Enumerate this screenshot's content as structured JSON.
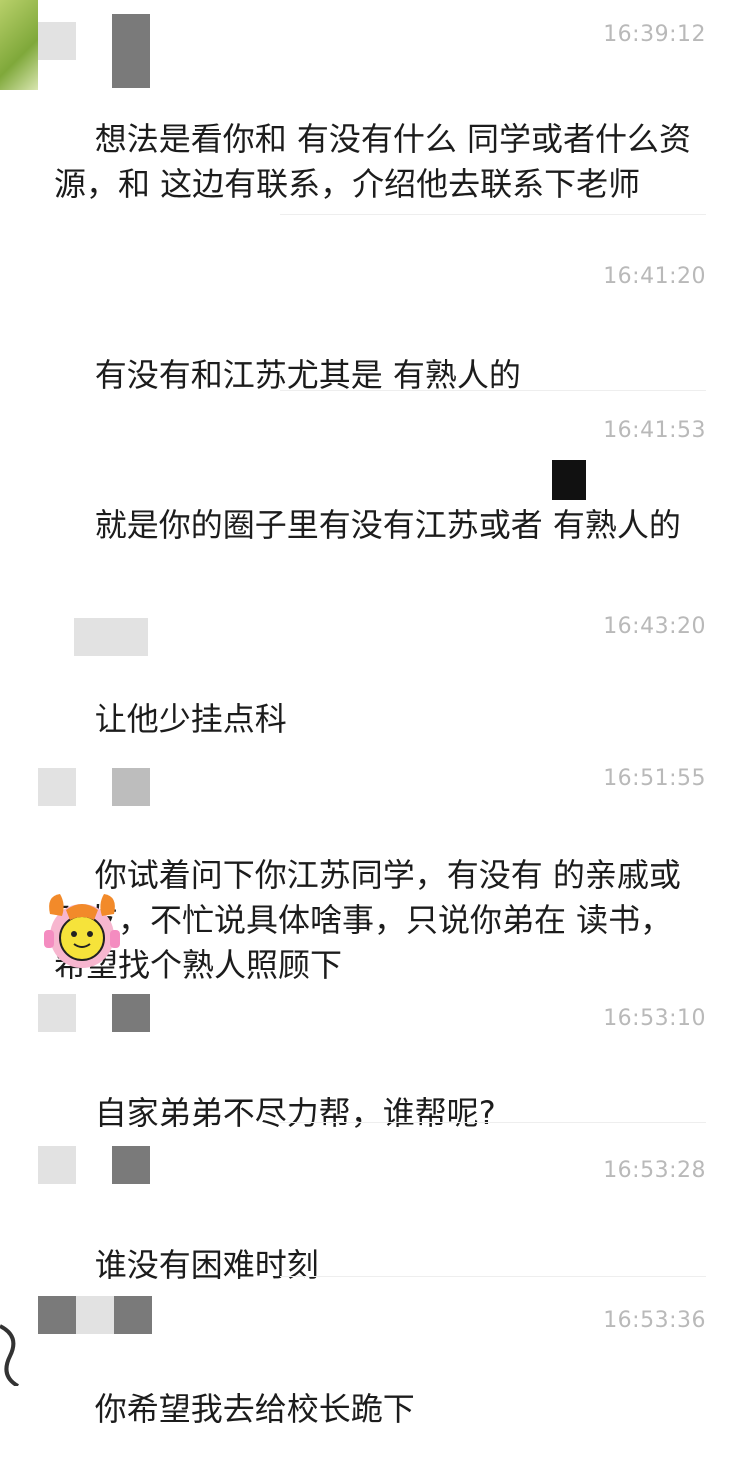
{
  "messages": [
    {
      "time": "16:39:12",
      "text": "想法是看你和 有没有什么 同学或者什么资源，和 这边有联系，介绍他去联系下老师"
    },
    {
      "time": "16:41:20",
      "text": "有没有和江苏尤其是 有熟人的"
    },
    {
      "time": "16:41:53",
      "text": "就是你的圈子里有没有江苏或者 有熟人的"
    },
    {
      "time": "16:43:20",
      "text": "让他少挂点科"
    },
    {
      "time": "16:51:55",
      "text": "你试着问下你江苏同学，有没有 的亲戚或朋友，不忙说具体啥事，只说你弟在 读书，希望找个熟人照顾下"
    },
    {
      "time": "16:53:10",
      "text": "自家弟弟不尽力帮，谁帮呢?"
    },
    {
      "time": "16:53:28",
      "text": "谁没有困难时刻"
    },
    {
      "time": "16:53:36",
      "text": "你希望我去给校长跪下"
    }
  ],
  "colors": {
    "timestamp": "#b9b9b9",
    "text": "#1c1c1c",
    "background": "#ffffff"
  },
  "icons": {
    "sticker": "cartoon-sticker-icon"
  }
}
